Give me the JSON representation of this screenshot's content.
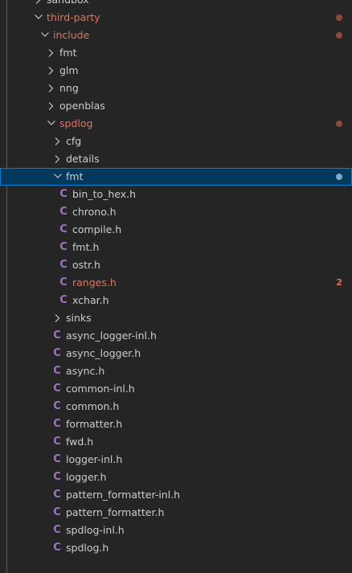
{
  "colors": {
    "background": "#252526",
    "text": "#cccccc",
    "modified": "#e2725b",
    "selection_bg": "#04395e",
    "selection_border": "#007fd4",
    "c_icon": "#a074c4"
  },
  "tree": [
    {
      "label": "sandbox",
      "kind": "folder",
      "depth": 2,
      "expanded": false,
      "modified": false
    },
    {
      "label": "third-party",
      "kind": "folder",
      "depth": 2,
      "expanded": true,
      "modified": true,
      "dot": true
    },
    {
      "label": "include",
      "kind": "folder",
      "depth": 3,
      "expanded": true,
      "modified": true,
      "dot": true
    },
    {
      "label": "fmt",
      "kind": "folder",
      "depth": 4,
      "expanded": false
    },
    {
      "label": "glm",
      "kind": "folder",
      "depth": 4,
      "expanded": false
    },
    {
      "label": "nng",
      "kind": "folder",
      "depth": 4,
      "expanded": false
    },
    {
      "label": "openblas",
      "kind": "folder",
      "depth": 4,
      "expanded": false
    },
    {
      "label": "spdlog",
      "kind": "folder",
      "depth": 4,
      "expanded": true,
      "modified": true,
      "dot": true
    },
    {
      "label": "cfg",
      "kind": "folder",
      "depth": 5,
      "expanded": false
    },
    {
      "label": "details",
      "kind": "folder",
      "depth": 5,
      "expanded": false
    },
    {
      "label": "fmt",
      "kind": "folder",
      "depth": 5,
      "expanded": true,
      "selected": true,
      "dot": true
    },
    {
      "label": "bin_to_hex.h",
      "kind": "file",
      "depth": 6,
      "icon": "C"
    },
    {
      "label": "chrono.h",
      "kind": "file",
      "depth": 6,
      "icon": "C"
    },
    {
      "label": "compile.h",
      "kind": "file",
      "depth": 6,
      "icon": "C"
    },
    {
      "label": "fmt.h",
      "kind": "file",
      "depth": 6,
      "icon": "C"
    },
    {
      "label": "ostr.h",
      "kind": "file",
      "depth": 6,
      "icon": "C"
    },
    {
      "label": "ranges.h",
      "kind": "file",
      "depth": 6,
      "icon": "C",
      "modified": true,
      "badge": "2"
    },
    {
      "label": "xchar.h",
      "kind": "file",
      "depth": 6,
      "icon": "C"
    },
    {
      "label": "sinks",
      "kind": "folder",
      "depth": 5,
      "expanded": false
    },
    {
      "label": "async_logger-inl.h",
      "kind": "file",
      "depth": 5,
      "icon": "C"
    },
    {
      "label": "async_logger.h",
      "kind": "file",
      "depth": 5,
      "icon": "C"
    },
    {
      "label": "async.h",
      "kind": "file",
      "depth": 5,
      "icon": "C"
    },
    {
      "label": "common-inl.h",
      "kind": "file",
      "depth": 5,
      "icon": "C"
    },
    {
      "label": "common.h",
      "kind": "file",
      "depth": 5,
      "icon": "C"
    },
    {
      "label": "formatter.h",
      "kind": "file",
      "depth": 5,
      "icon": "C"
    },
    {
      "label": "fwd.h",
      "kind": "file",
      "depth": 5,
      "icon": "C"
    },
    {
      "label": "logger-inl.h",
      "kind": "file",
      "depth": 5,
      "icon": "C"
    },
    {
      "label": "logger.h",
      "kind": "file",
      "depth": 5,
      "icon": "C"
    },
    {
      "label": "pattern_formatter-inl.h",
      "kind": "file",
      "depth": 5,
      "icon": "C"
    },
    {
      "label": "pattern_formatter.h",
      "kind": "file",
      "depth": 5,
      "icon": "C"
    },
    {
      "label": "spdlog-inl.h",
      "kind": "file",
      "depth": 5,
      "icon": "C"
    },
    {
      "label": "spdlog.h",
      "kind": "file",
      "depth": 5,
      "icon": "C"
    }
  ]
}
